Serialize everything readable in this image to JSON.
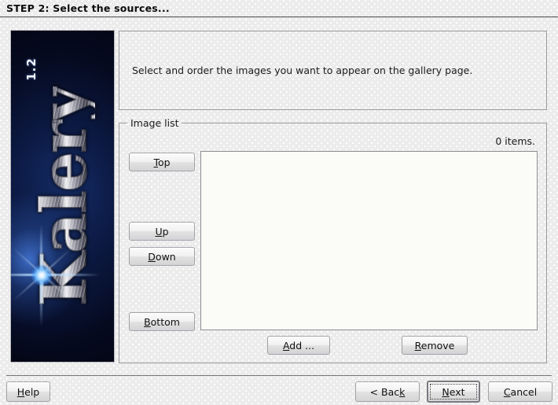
{
  "header": {
    "title": "STEP 2: Select the sources..."
  },
  "banner": {
    "version": "1.2",
    "wordmark": "Kalery"
  },
  "description": {
    "text": "Select and order the images you want to appear on the gallery page."
  },
  "image_list": {
    "legend": "Image list",
    "item_count": "0 items.",
    "items": [],
    "order_buttons": [
      {
        "id": "top",
        "label": "Top",
        "mnemonic": "T"
      },
      {
        "id": "up",
        "label": "Up",
        "mnemonic": "U"
      },
      {
        "id": "down",
        "label": "Down",
        "mnemonic": "D"
      },
      {
        "id": "bottom",
        "label": "Bottom",
        "mnemonic": "B"
      }
    ],
    "add_label": "Add ...",
    "add_mnemonic": "A",
    "remove_label": "Remove",
    "remove_mnemonic": "R"
  },
  "footer": {
    "help_label": "Help",
    "help_mnemonic": "H",
    "back_label": "< Back",
    "back_mnemonic": "k",
    "next_label": "Next",
    "next_mnemonic": "N",
    "cancel_label": "Cancel",
    "cancel_mnemonic": "C",
    "default_button": "Next"
  },
  "colors": {
    "background": "#ececec",
    "listbox_background": "#fbfbf8",
    "border": "#9a9aa0",
    "text": "#1b1b1b",
    "banner_dark": "#05081a",
    "banner_blue": "#16306e",
    "flare": "#ffffff"
  }
}
